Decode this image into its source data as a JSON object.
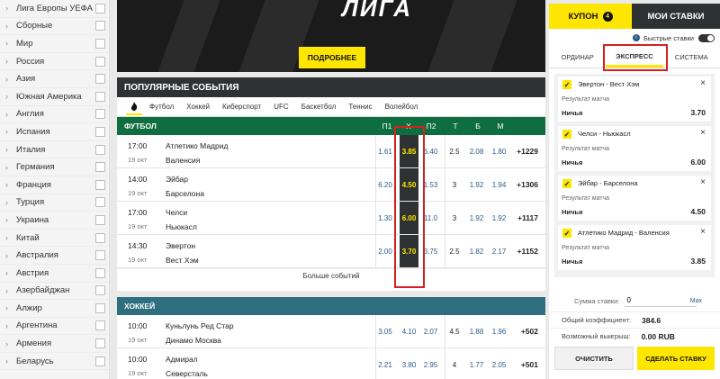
{
  "sidebar": {
    "items": [
      "Лига Европы УЕФА",
      "Сборные",
      "Мир",
      "Россия",
      "Азия",
      "Южная Америка",
      "Англия",
      "Испания",
      "Италия",
      "Германия",
      "Франция",
      "Турция",
      "Украина",
      "Китай",
      "Австралия",
      "Австрия",
      "Азербайджан",
      "Алжир",
      "Аргентина",
      "Армения",
      "Беларусь"
    ]
  },
  "banner": {
    "logo_text": "ЛИГА",
    "more_label": "ПОДРОБНЕЕ"
  },
  "popular": {
    "title": "ПОПУЛЯРНЫЕ СОБЫТИЯ",
    "tabs": [
      "Футбол",
      "Хоккей",
      "Киберспорт",
      "UFC",
      "Баскетбол",
      "Теннис",
      "Волейбол"
    ],
    "more_events": "Больше событий"
  },
  "columns": [
    "П1",
    "X",
    "П2",
    "Т",
    "Б",
    "М"
  ],
  "football": {
    "title": "ФУТБОЛ",
    "events": [
      {
        "time": "17:00",
        "date": "19 окт",
        "team1": "Атлетико Мадрид",
        "team2": "Валенсия",
        "p1": "1.61",
        "x": "3.85",
        "p2": "6.40",
        "t": "2.5",
        "b": "2.08",
        "m": "1.80",
        "total": "+1229"
      },
      {
        "time": "14:00",
        "date": "19 окт",
        "team1": "Эйбар",
        "team2": "Барселона",
        "p1": "6.20",
        "x": "4.50",
        "p2": "1.53",
        "t": "3",
        "b": "1.92",
        "m": "1.94",
        "total": "+1306"
      },
      {
        "time": "17:00",
        "date": "19 окт",
        "team1": "Челси",
        "team2": "Ньюкасл",
        "p1": "1.30",
        "x": "6.00",
        "p2": "11.0",
        "t": "3",
        "b": "1.92",
        "m": "1.92",
        "total": "+1117"
      },
      {
        "time": "14:30",
        "date": "19 окт",
        "team1": "Эвертон",
        "team2": "Вест Хэм",
        "p1": "2.00",
        "x": "3.70",
        "p2": "3.75",
        "t": "2.5",
        "b": "1.82",
        "m": "2.17",
        "total": "+1152"
      }
    ]
  },
  "hockey": {
    "title": "ХОККЕЙ",
    "events": [
      {
        "time": "10:00",
        "date": "19 окт",
        "team1": "Куньлунь Ред Стар",
        "team2": "Динамо Москва",
        "p1": "3.05",
        "x": "4.10",
        "p2": "2.07",
        "t": "4.5",
        "b": "1.88",
        "m": "1.96",
        "total": "+502"
      },
      {
        "time": "10:00",
        "date": "19 окт",
        "team1": "Адмирал",
        "team2": "Северсталь",
        "p1": "2.21",
        "x": "3.80",
        "p2": "2.95",
        "t": "4",
        "b": "1.77",
        "m": "2.05",
        "total": "+501"
      }
    ]
  },
  "coupon": {
    "tab_coupon": "КУПОН",
    "badge": "4",
    "tab_my_bets": "МОИ СТАВКИ",
    "fast_bets": "Быстрые ставки",
    "types": [
      "ОРДИНАР",
      "ЭКСПРЕСС",
      "СИСТЕМА"
    ],
    "result_label": "Результат матча",
    "slips": [
      {
        "match": "Эвертон - Вест Хэм",
        "outcome": "Ничья",
        "odd": "3.70"
      },
      {
        "match": "Челси - Ньюкасл",
        "outcome": "Ничья",
        "odd": "6.00"
      },
      {
        "match": "Эйбар - Барселона",
        "outcome": "Ничья",
        "odd": "4.50"
      },
      {
        "match": "Атлетико Мадрид - Валенсия",
        "outcome": "Ничья",
        "odd": "3.85"
      }
    ],
    "stake_label": "Сумма ставки:",
    "stake_value": "0",
    "stake_max": "Max",
    "coef_label": "Общий коэффициент:",
    "coef_value": "384.6",
    "win_label": "Возможный выигрыш:",
    "win_value": "0.00 RUB",
    "clear_label": "ОЧИСТИТЬ",
    "place_label": "СДЕЛАТЬ СТАВКУ"
  }
}
